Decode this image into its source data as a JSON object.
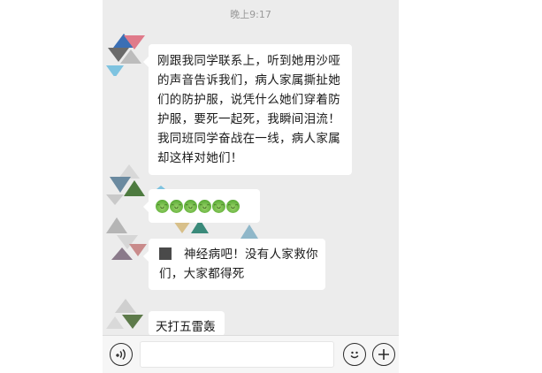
{
  "status": {
    "time": "晚上9:17"
  },
  "messages": [
    {
      "text": "刚跟我同学联系上，听到她用沙哑的声音告诉我们，病人家属撕扯她们的防护服，说凭什么她们穿着防护服，要死一起死，我瞬间泪流！我同班同学奋战在一线，病人家属却这样对她们！"
    },
    {
      "emoji_count": 6,
      "emoji_name": "frog-face-emoji"
    },
    {
      "text": "神经病吧！没有人家救你们，大家都得死"
    },
    {
      "text": "天打五雷轰"
    }
  ],
  "input_bar": {
    "voice_icon": "voice-icon",
    "emoji_icon": "smiley-icon",
    "plus_icon": "plus-icon"
  },
  "colors": {
    "chat_background": "#ececec",
    "bubble": "#ffffff",
    "time_text": "#9a9a9a"
  }
}
